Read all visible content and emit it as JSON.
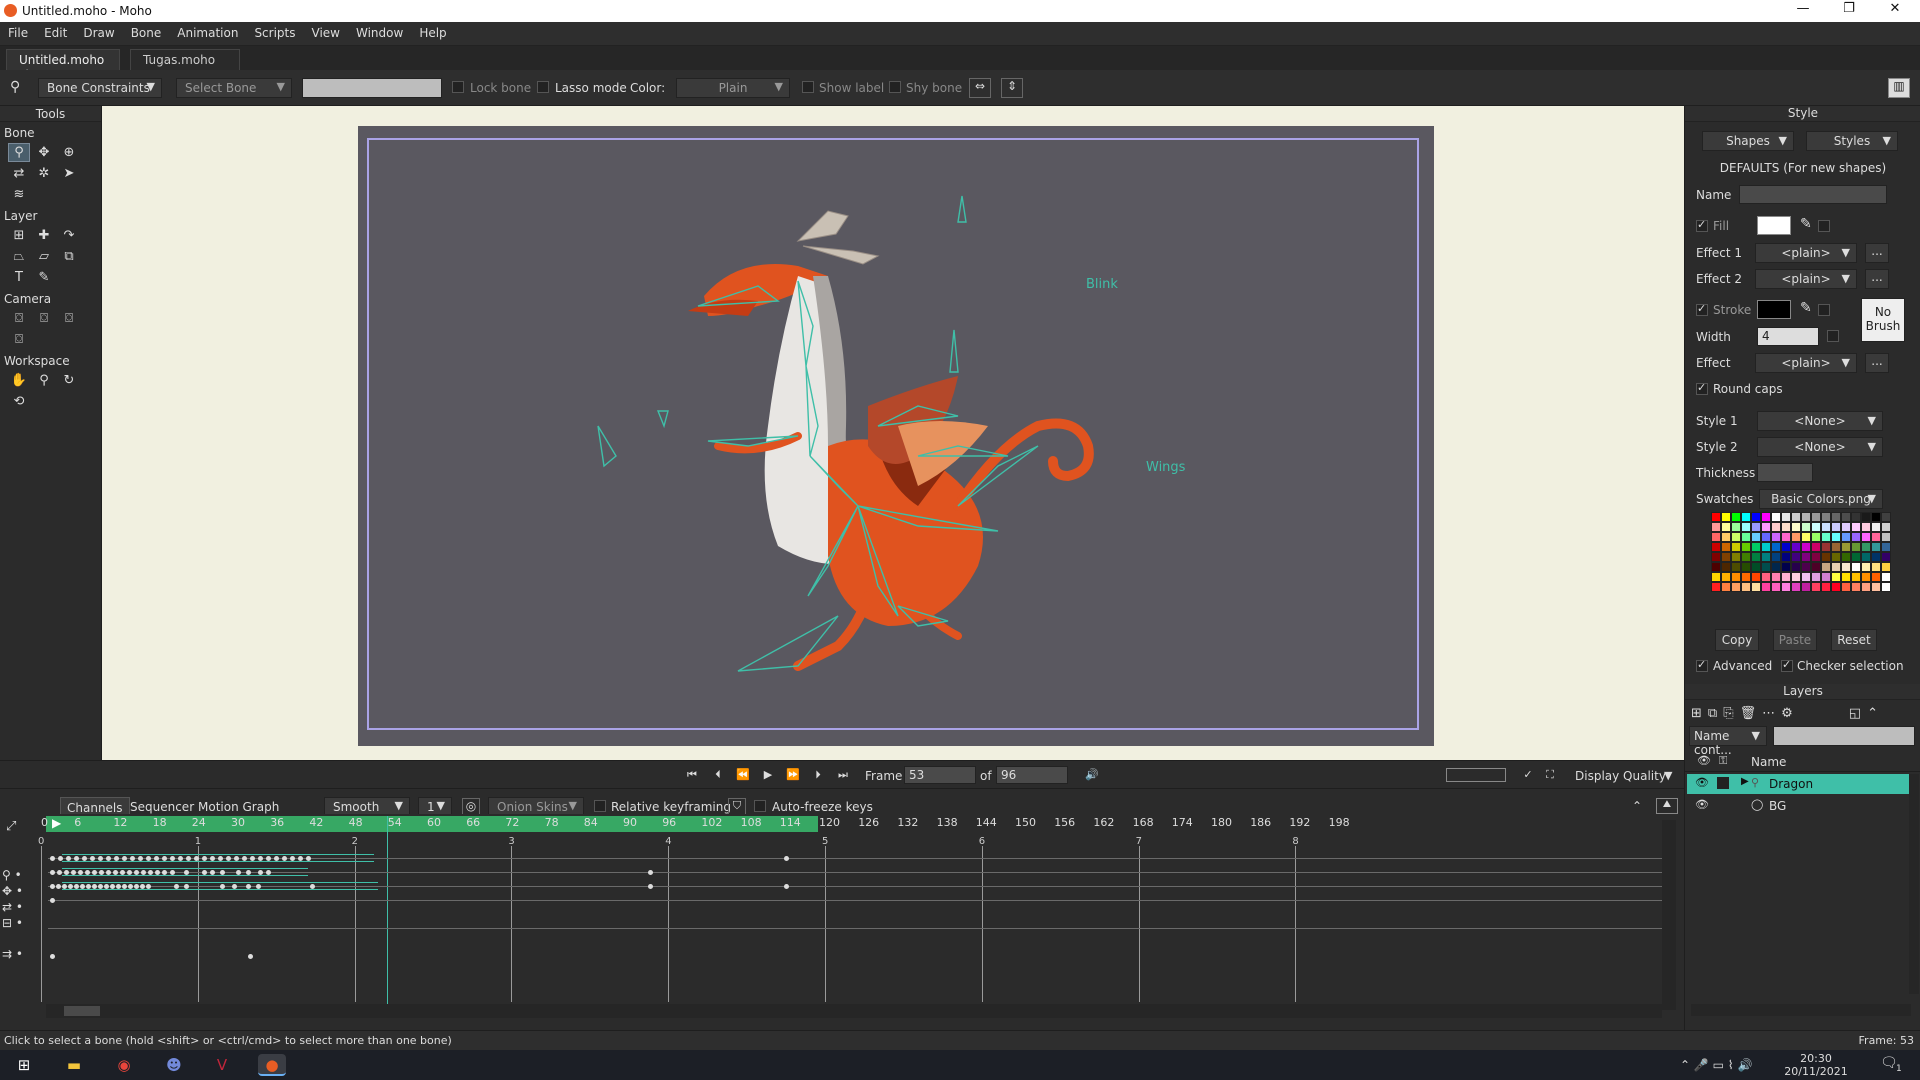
{
  "window": {
    "title": "Untitled.moho - Moho",
    "controls": {
      "minimize": "—",
      "maximize": "❐",
      "close": "✕"
    }
  },
  "menu": [
    "File",
    "Edit",
    "Draw",
    "Bone",
    "Animation",
    "Scripts",
    "View",
    "Window",
    "Help"
  ],
  "doc_tabs": [
    {
      "label": "Untitled.moho ✐",
      "active": true
    },
    {
      "label": "Tugas.moho",
      "active": false
    }
  ],
  "tool_options": {
    "mode_dropdown": "Bone Constraints",
    "select_bone_dropdown": "Select Bone",
    "lock_bone": "Lock bone",
    "lasso_mode": "Lasso mode",
    "color_label": "Color:",
    "color_dropdown": "Plain",
    "show_label": "Show label",
    "shy_bone": "Shy bone"
  },
  "tools_panel": {
    "title": "Tools",
    "sections": [
      {
        "name": "Bone",
        "icons": [
          "select-bone-icon",
          "transform-bone-icon",
          "add-bone-icon",
          "reparent-bone-icon",
          "bone-strength-icon",
          "manipulate-bones-icon",
          "bind-layer-icon"
        ]
      },
      {
        "name": "Layer",
        "icons": [
          "set-origin-icon",
          "translate-layer-icon",
          "rotate-layer-icon",
          "scale-layer-icon",
          "shear-layer-icon",
          "switch-layer-icon",
          "text-icon",
          "eyedropper-icon"
        ]
      },
      {
        "name": "Camera",
        "icons": [
          "track-camera-icon",
          "zoom-camera-icon",
          "roll-camera-icon",
          "pan-tilt-camera-icon"
        ]
      },
      {
        "name": "Workspace",
        "icons": [
          "hand-icon",
          "zoom-icon",
          "rotate-workspace-icon",
          "orbit-workspace-icon"
        ]
      }
    ]
  },
  "canvas": {
    "bone_labels": [
      "Blink",
      "Wings"
    ]
  },
  "style_panel": {
    "title": "Style",
    "shapes_dd": "Shapes",
    "styles_dd": "Styles",
    "defaults_caption": "DEFAULTS (For new shapes)",
    "name_label": "Name",
    "fill_label": "Fill",
    "effect1_label": "Effect 1",
    "effect1_value": "<plain>",
    "effect2_label": "Effect 2",
    "effect2_value": "<plain>",
    "stroke_label": "Stroke",
    "no_brush": "No Brush",
    "width_label": "Width",
    "width_value": "4",
    "effect_label": "Effect",
    "effect_value": "<plain>",
    "round_caps": "Round caps",
    "style1_label": "Style 1",
    "style1_value": "<None>",
    "style2_label": "Style 2",
    "style2_value": "<None>",
    "thickness_label": "Thickness",
    "swatches_label": "Swatches",
    "swatches_value": "Basic Colors.png",
    "copy_btn": "Copy",
    "paste_btn": "Paste",
    "reset_btn": "Reset",
    "advanced": "Advanced",
    "checker_selection": "Checker selection",
    "more_btn": "...",
    "fill_color": "#ffffff",
    "stroke_color": "#000000"
  },
  "layers_panel": {
    "title": "Layers",
    "filter_dd": "Name cont...",
    "name_col": "Name",
    "layers": [
      {
        "name": "Dragon",
        "selected": true
      },
      {
        "name": "BG",
        "selected": false
      }
    ]
  },
  "playback": {
    "frame_label": "Frame",
    "frame_value": "53",
    "of_label": "of",
    "total_value": "96",
    "display_quality": "Display Quality"
  },
  "timeline": {
    "tabs": [
      "Channels",
      "Sequencer",
      "Motion Graph"
    ],
    "interp_dd": "Smooth",
    "interp_num": "1",
    "onion_skins": "Onion Skins",
    "relative_keyframing": "Relative keyframing",
    "auto_freeze": "Auto-freeze keys",
    "ruler_ticks": [
      "0",
      "6",
      "12",
      "18",
      "24",
      "30",
      "36",
      "42",
      "48",
      "54",
      "60",
      "66",
      "72",
      "78",
      "84",
      "90",
      "96",
      "102",
      "108",
      "114",
      "120",
      "126",
      "132",
      "138",
      "144",
      "150",
      "156",
      "162",
      "168",
      "174",
      "180",
      "186",
      "192",
      "198"
    ],
    "second_marks": [
      "0",
      "1",
      "2",
      "3",
      "4",
      "5",
      "6",
      "7",
      "8"
    ],
    "current_frame": 53
  },
  "status": {
    "message": "Click to select a bone (hold <shift> or <ctrl/cmd> to select more than one bone)",
    "frame_readout": "Frame: 53"
  },
  "taskbar": {
    "time": "20:30",
    "date": "20/11/2021",
    "notification_count": "1"
  },
  "colors": {
    "accent_teal": "#3fbfa8",
    "ruler_green": "#37a864",
    "stage_frame": "#aaa3e6",
    "dragon_orange": "#e0531f"
  }
}
